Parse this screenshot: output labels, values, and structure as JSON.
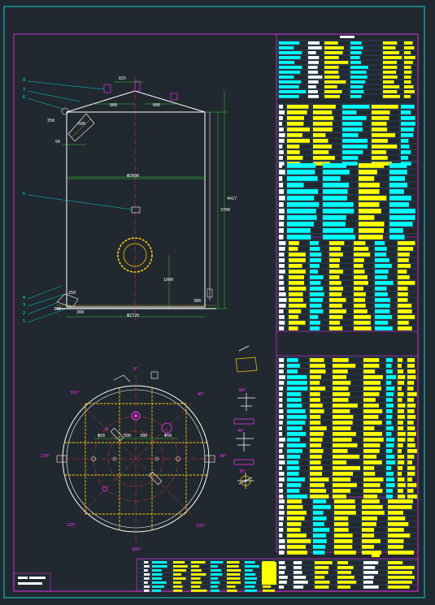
{
  "colors": {
    "background": "#212830",
    "frame": "#00ffff",
    "border": "#ff33ff",
    "tank_outline": "#ffffff",
    "dimension": "#33ff33",
    "centerline": "#ff3333",
    "structure": "#ffcc00",
    "table_text": "#ffff00"
  },
  "front_view": {
    "callouts": {
      "c9": "9",
      "c7": "7",
      "c6": "6",
      "c5": "5",
      "c4": "4",
      "c3": "3",
      "c2": "2",
      "c1": "1"
    },
    "dims": {
      "roof_top": "825",
      "roof_left": "800",
      "roof_right": "600",
      "manhole_w": "500",
      "nozzle_50": "50",
      "diameter_inner": "Φ2600",
      "height_shell": "3700",
      "height_total": "4417",
      "manhole_elev": "1000",
      "bottom_w": "Φ2720",
      "bottom_left": "300",
      "bottom_right": "300",
      "side_350": "350",
      "side_250": "250",
      "side_300": "300"
    }
  },
  "plan_view": {
    "dims": {
      "left_gap": "Φ50",
      "center_a": "500",
      "center_b": "300",
      "right_gap": "Φ50",
      "angle_top": "0°",
      "angle_bottom": "180°",
      "angle_left": "270°",
      "angle_right": "90°",
      "angle_45": "45°",
      "angle_135": "135°",
      "angle_225": "225°",
      "angle_315": "315°"
    }
  },
  "details": {
    "angles": {
      "a60": "60°",
      "a45": "45°",
      "a30": "30°"
    }
  }
}
